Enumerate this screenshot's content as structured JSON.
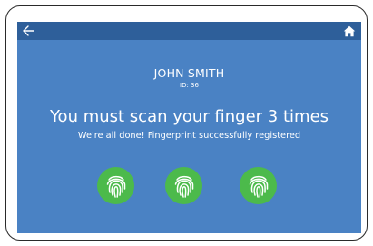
{
  "screen": {
    "nav": {
      "back_icon": "arrow-left-icon",
      "home_icon": "home-icon"
    },
    "user": {
      "name": "JOHN SMITH",
      "id_text": "ID: 36"
    },
    "message": {
      "headline": "You must scan your finger 3 times",
      "status": "We're all done! Fingerprint successfully registered"
    },
    "scans": {
      "required": 3,
      "completed": 3,
      "icon": "fingerprint-icon"
    },
    "colors": {
      "background": "#4a82c4",
      "topbar": "#2e5f9a",
      "scan_complete": "#4cba4b",
      "text": "#ffffff"
    }
  }
}
